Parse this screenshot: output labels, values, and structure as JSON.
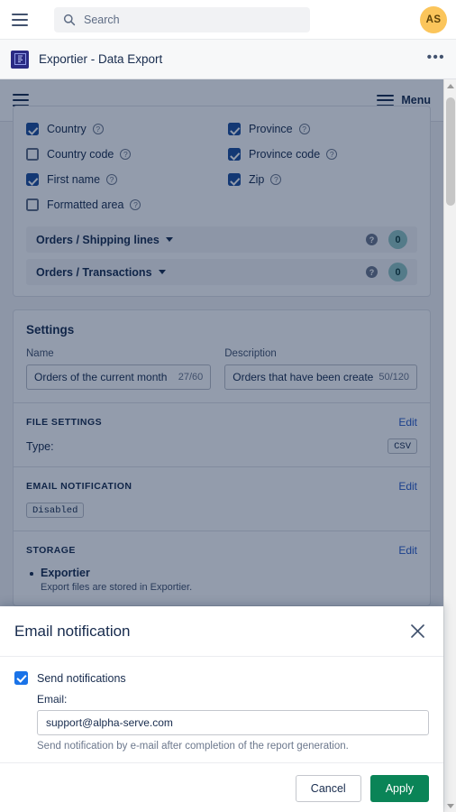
{
  "browser": {
    "menu_icon": "hamburger-icon",
    "search": {
      "icon": "search-icon",
      "placeholder": "Search"
    },
    "avatar": {
      "initials": "AS",
      "color": "#fbc55b"
    }
  },
  "app_header": {
    "icon": "exportier-app-icon",
    "title": "Exportier - Data Export",
    "more": "•••"
  },
  "frame_menubar": {
    "menu_icon": "hamburger-icon",
    "menu_label": "Menu"
  },
  "fields": {
    "left": [
      {
        "label": "Country",
        "checked": true,
        "help": "?"
      },
      {
        "label": "Country code",
        "checked": false,
        "help": "?"
      },
      {
        "label": "First name",
        "checked": true,
        "help": "?"
      },
      {
        "label": "Formatted area",
        "checked": false,
        "help": "?"
      }
    ],
    "right": [
      {
        "label": "Province",
        "checked": true,
        "help": "?"
      },
      {
        "label": "Province code",
        "checked": true,
        "help": "?"
      },
      {
        "label": "Zip",
        "checked": true,
        "help": "?"
      }
    ]
  },
  "accordions": [
    {
      "title": "Orders / Shipping lines",
      "help": "?",
      "count": "0"
    },
    {
      "title": "Orders / Transactions",
      "help": "?",
      "count": "0"
    }
  ],
  "settings": {
    "heading": "Settings",
    "name": {
      "label": "Name",
      "value": "Orders of the current month",
      "counter": "27/60"
    },
    "description": {
      "label": "Description",
      "value": "Orders that have been create",
      "counter": "50/120"
    },
    "file_settings": {
      "heading": "FILE SETTINGS",
      "edit": "Edit",
      "type_label": "Type:",
      "type_value": "CSV"
    },
    "email_notification": {
      "heading": "EMAIL NOTIFICATION",
      "edit": "Edit",
      "status": "Disabled"
    },
    "storage": {
      "heading": "STORAGE",
      "edit": "Edit",
      "item_name": "Exportier",
      "item_desc": "Export files are stored in Exportier."
    }
  },
  "modal": {
    "title": "Email notification",
    "close_icon": "close-icon",
    "send_notifications": {
      "label": "Send notifications",
      "checked": true
    },
    "email": {
      "label": "Email:",
      "value": "support@alpha-serve.com"
    },
    "hint": "Send notification by e-mail after completion of the report generation.",
    "cancel": "Cancel",
    "apply": "Apply",
    "apply_color": "#0a8457"
  },
  "scrollbar": {
    "up": "scroll-up-arrow",
    "down": "scroll-down-arrow"
  }
}
